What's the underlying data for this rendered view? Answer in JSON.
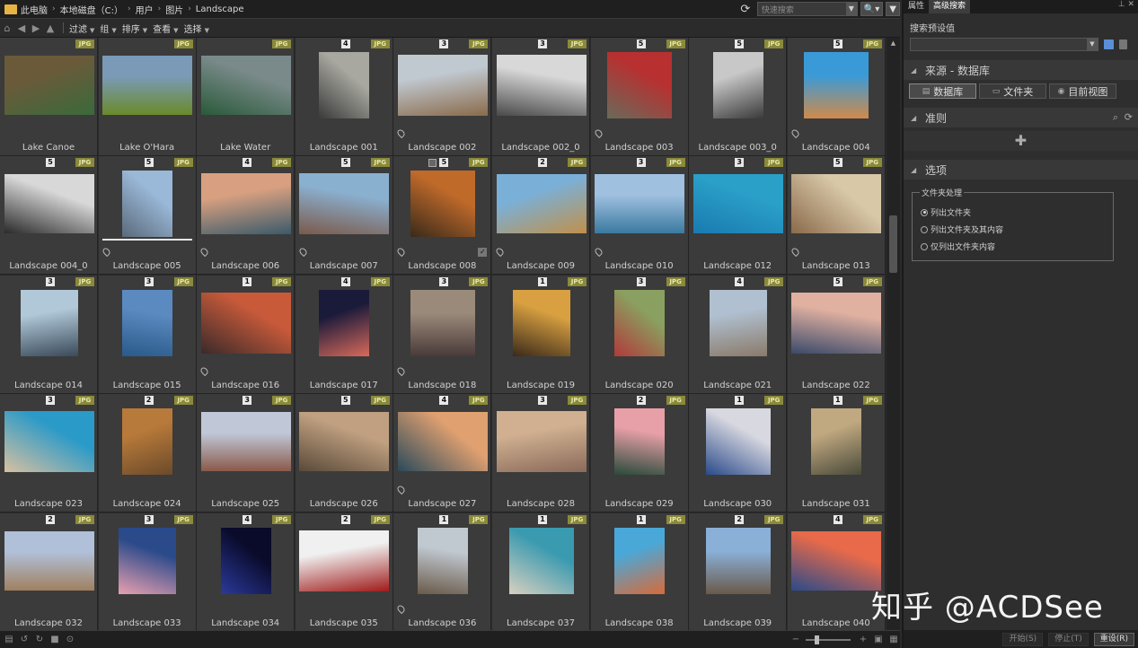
{
  "breadcrumb": [
    "此电脑",
    "本地磁盘（C:）",
    "用户",
    "图片",
    "Landscape"
  ],
  "quick_search": {
    "placeholder": "快速搜索"
  },
  "toolbar": {
    "filter": "过滤",
    "group": "组",
    "sort": "排序",
    "view": "查看",
    "select": "选择"
  },
  "badge_label": "JPG",
  "files": [
    {
      "name": "Lake Canoe",
      "rating": "",
      "gps": false,
      "c1": "#6a5a3a",
      "c2": "#3a6a3a"
    },
    {
      "name": "Lake O'Hara",
      "rating": "",
      "gps": false,
      "c1": "#7a9ab8",
      "c2": "#6a8a2a"
    },
    {
      "name": "Lake Water",
      "rating": "",
      "gps": false,
      "c1": "#7a8a8a",
      "c2": "#2a5a3a"
    },
    {
      "name": "Landscape 001",
      "rating": "4",
      "gps": false,
      "c1": "#a8a8a0",
      "c2": "#3a3a3a"
    },
    {
      "name": "Landscape 002",
      "rating": "3",
      "gps": true,
      "c1": "#c0c8d0",
      "c2": "#8a6a4a"
    },
    {
      "name": "Landscape 002_0",
      "rating": "3",
      "gps": false,
      "c1": "#d8d8d8",
      "c2": "#4a4a4a"
    },
    {
      "name": "Landscape 003",
      "rating": "5",
      "gps": true,
      "c1": "#b83030",
      "c2": "#6a6a5a"
    },
    {
      "name": "Landscape 003_0",
      "rating": "5",
      "gps": false,
      "c1": "#c8c8c8",
      "c2": "#3a3a3a"
    },
    {
      "name": "Landscape 004",
      "rating": "5",
      "gps": true,
      "c1": "#3a9ad8",
      "c2": "#d08a4a"
    },
    {
      "name": "Landscape 004_0",
      "rating": "5",
      "gps": false,
      "c1": "#d8d8d8",
      "c2": "#2a2a2a"
    },
    {
      "name": "Landscape 005",
      "rating": "5",
      "gps": true,
      "c1": "#9ab8d8",
      "c2": "#5a6a7a"
    },
    {
      "name": "Landscape 006",
      "rating": "4",
      "gps": true,
      "c1": "#d8a080",
      "c2": "#3a5a6a"
    },
    {
      "name": "Landscape 007",
      "rating": "5",
      "gps": true,
      "c1": "#8ab0d0",
      "c2": "#7a5a4a"
    },
    {
      "name": "Landscape 008",
      "rating": "5",
      "gps": true,
      "c1": "#c06a2a",
      "c2": "#3a2a1a"
    },
    {
      "name": "Landscape 009",
      "rating": "2",
      "gps": true,
      "c1": "#7ab0d8",
      "c2": "#c0904a"
    },
    {
      "name": "Landscape 010",
      "rating": "3",
      "gps": true,
      "c1": "#a0c0e0",
      "c2": "#3a7aa0"
    },
    {
      "name": "Landscape 012",
      "rating": "3",
      "gps": false,
      "c1": "#2aa0c8",
      "c2": "#1a7ab0"
    },
    {
      "name": "Landscape 013",
      "rating": "5",
      "gps": true,
      "c1": "#d8c8a8",
      "c2": "#8a6a4a"
    },
    {
      "name": "Landscape 014",
      "rating": "3",
      "gps": false,
      "c1": "#b0c8d8",
      "c2": "#3a4a5a"
    },
    {
      "name": "Landscape 015",
      "rating": "3",
      "gps": false,
      "c1": "#5a8ac0",
      "c2": "#2a5a8a"
    },
    {
      "name": "Landscape 016",
      "rating": "1",
      "gps": true,
      "c1": "#c85a3a",
      "c2": "#3a2a2a"
    },
    {
      "name": "Landscape 017",
      "rating": "4",
      "gps": false,
      "c1": "#1a1a3a",
      "c2": "#d86a5a"
    },
    {
      "name": "Landscape 018",
      "rating": "3",
      "gps": true,
      "c1": "#9a8a7a",
      "c2": "#4a3a3a"
    },
    {
      "name": "Landscape 019",
      "rating": "1",
      "gps": false,
      "c1": "#d8a040",
      "c2": "#3a2a1a"
    },
    {
      "name": "Landscape 020",
      "rating": "3",
      "gps": false,
      "c1": "#8aa060",
      "c2": "#b03a3a"
    },
    {
      "name": "Landscape 021",
      "rating": "4",
      "gps": false,
      "c1": "#b0c0d0",
      "c2": "#8a7a6a"
    },
    {
      "name": "Landscape 022",
      "rating": "5",
      "gps": false,
      "c1": "#e0b0a0",
      "c2": "#3a4a6a"
    },
    {
      "name": "Landscape 023",
      "rating": "3",
      "gps": false,
      "c1": "#2a9ac8",
      "c2": "#d8c0a0"
    },
    {
      "name": "Landscape 024",
      "rating": "2",
      "gps": false,
      "c1": "#b87a3a",
      "c2": "#6a4a2a"
    },
    {
      "name": "Landscape 025",
      "rating": "3",
      "gps": false,
      "c1": "#c0c8d8",
      "c2": "#8a5a4a"
    },
    {
      "name": "Landscape 026",
      "rating": "5",
      "gps": false,
      "c1": "#c0a080",
      "c2": "#5a4a3a"
    },
    {
      "name": "Landscape 027",
      "rating": "4",
      "gps": true,
      "c1": "#e0a070",
      "c2": "#2a4a5a"
    },
    {
      "name": "Landscape 028",
      "rating": "3",
      "gps": false,
      "c1": "#d0b090",
      "c2": "#8a6a5a"
    },
    {
      "name": "Landscape 029",
      "rating": "2",
      "gps": false,
      "c1": "#e8a0a8",
      "c2": "#2a4a3a"
    },
    {
      "name": "Landscape 030",
      "rating": "1",
      "gps": false,
      "c1": "#d8d8e0",
      "c2": "#2a4a8a"
    },
    {
      "name": "Landscape 031",
      "rating": "1",
      "gps": false,
      "c1": "#c0a880",
      "c2": "#4a4a3a"
    },
    {
      "name": "Landscape 032",
      "rating": "2",
      "gps": false,
      "c1": "#b0c0d8",
      "c2": "#a08060"
    },
    {
      "name": "Landscape 033",
      "rating": "3",
      "gps": false,
      "c1": "#2a4a8a",
      "c2": "#e8a0b0"
    },
    {
      "name": "Landscape 034",
      "rating": "4",
      "gps": false,
      "c1": "#0a0a2a",
      "c2": "#2a3a9a"
    },
    {
      "name": "Landscape 035",
      "rating": "2",
      "gps": false,
      "c1": "#f0f0f0",
      "c2": "#a01a1a"
    },
    {
      "name": "Landscape 036",
      "rating": "1",
      "gps": true,
      "c1": "#c0c8d0",
      "c2": "#6a5a4a"
    },
    {
      "name": "Landscape 037",
      "rating": "1",
      "gps": false,
      "c1": "#3a9ab0",
      "c2": "#d8d0c0"
    },
    {
      "name": "Landscape 038",
      "rating": "1",
      "gps": false,
      "c1": "#4aa8d8",
      "c2": "#d86a3a"
    },
    {
      "name": "Landscape 039",
      "rating": "2",
      "gps": false,
      "c1": "#8ab0d8",
      "c2": "#6a5a4a"
    },
    {
      "name": "Landscape 040",
      "rating": "4",
      "gps": false,
      "c1": "#e86a4a",
      "c2": "#2a4a8a"
    }
  ],
  "right_panel": {
    "tab_properties": "属性",
    "tab_advanced": "高级搜索",
    "preset_label": "搜索预设值",
    "source_title": "来源 - 数据库",
    "btn_database": "数据库",
    "btn_folder": "文件夹",
    "btn_current_view": "目前视图",
    "criteria_title": "准则",
    "options_title": "选项",
    "folder_group_title": "文件夹处理",
    "radio_1": "列出文件夹",
    "radio_2": "列出文件夹及其内容",
    "radio_3": "仅列出文件夹内容",
    "btn_start": "开始(S)",
    "btn_stop": "停止(T)",
    "btn_reset": "重设(R)"
  },
  "watermark": "知乎 @ACDSee",
  "colors": {
    "background": "#2b2b2b",
    "tile": "#3b3b3b",
    "jpg_badge": "#8a8a3a"
  }
}
